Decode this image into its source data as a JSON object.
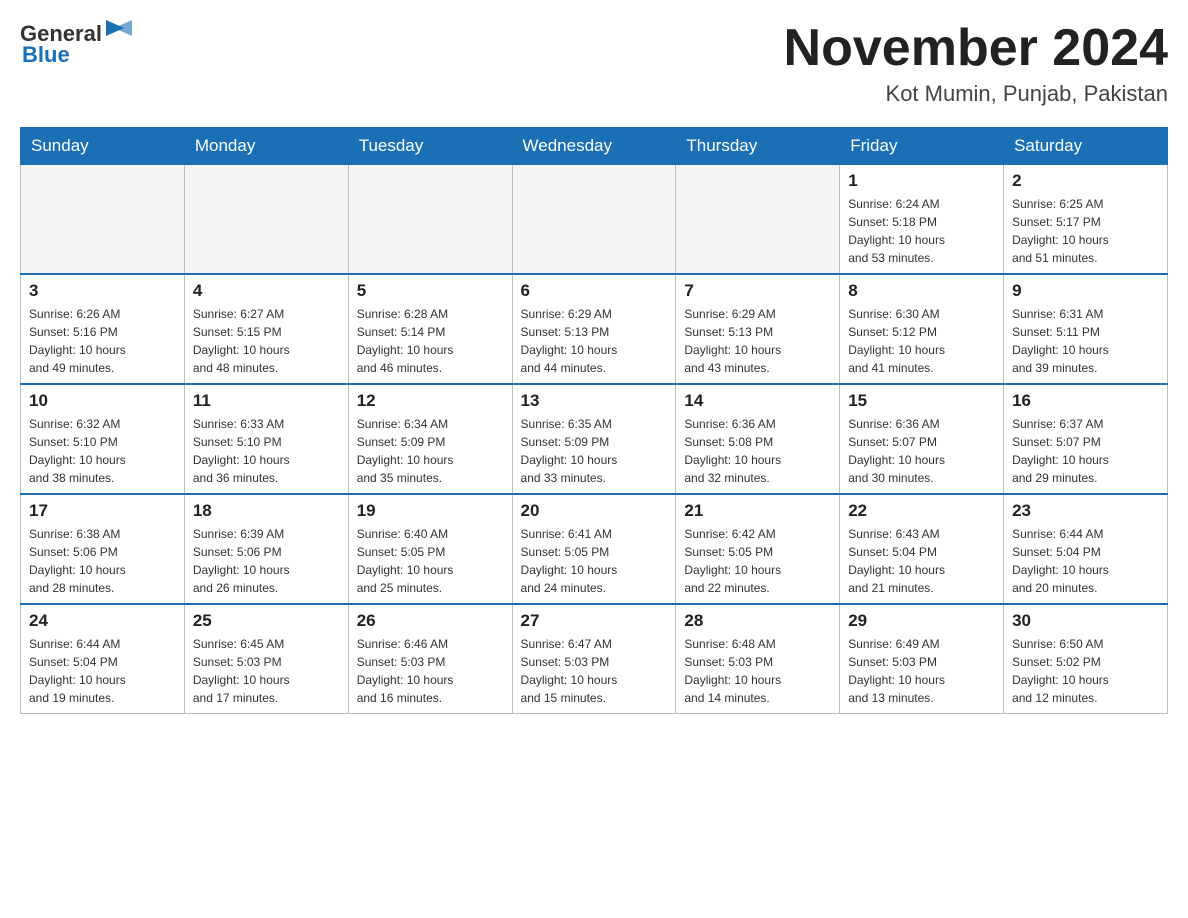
{
  "header": {
    "logo_general": "General",
    "logo_blue": "Blue",
    "title": "November 2024",
    "subtitle": "Kot Mumin, Punjab, Pakistan"
  },
  "weekdays": [
    "Sunday",
    "Monday",
    "Tuesday",
    "Wednesday",
    "Thursday",
    "Friday",
    "Saturday"
  ],
  "weeks": [
    [
      {
        "day": "",
        "info": ""
      },
      {
        "day": "",
        "info": ""
      },
      {
        "day": "",
        "info": ""
      },
      {
        "day": "",
        "info": ""
      },
      {
        "day": "",
        "info": ""
      },
      {
        "day": "1",
        "info": "Sunrise: 6:24 AM\nSunset: 5:18 PM\nDaylight: 10 hours\nand 53 minutes."
      },
      {
        "day": "2",
        "info": "Sunrise: 6:25 AM\nSunset: 5:17 PM\nDaylight: 10 hours\nand 51 minutes."
      }
    ],
    [
      {
        "day": "3",
        "info": "Sunrise: 6:26 AM\nSunset: 5:16 PM\nDaylight: 10 hours\nand 49 minutes."
      },
      {
        "day": "4",
        "info": "Sunrise: 6:27 AM\nSunset: 5:15 PM\nDaylight: 10 hours\nand 48 minutes."
      },
      {
        "day": "5",
        "info": "Sunrise: 6:28 AM\nSunset: 5:14 PM\nDaylight: 10 hours\nand 46 minutes."
      },
      {
        "day": "6",
        "info": "Sunrise: 6:29 AM\nSunset: 5:13 PM\nDaylight: 10 hours\nand 44 minutes."
      },
      {
        "day": "7",
        "info": "Sunrise: 6:29 AM\nSunset: 5:13 PM\nDaylight: 10 hours\nand 43 minutes."
      },
      {
        "day": "8",
        "info": "Sunrise: 6:30 AM\nSunset: 5:12 PM\nDaylight: 10 hours\nand 41 minutes."
      },
      {
        "day": "9",
        "info": "Sunrise: 6:31 AM\nSunset: 5:11 PM\nDaylight: 10 hours\nand 39 minutes."
      }
    ],
    [
      {
        "day": "10",
        "info": "Sunrise: 6:32 AM\nSunset: 5:10 PM\nDaylight: 10 hours\nand 38 minutes."
      },
      {
        "day": "11",
        "info": "Sunrise: 6:33 AM\nSunset: 5:10 PM\nDaylight: 10 hours\nand 36 minutes."
      },
      {
        "day": "12",
        "info": "Sunrise: 6:34 AM\nSunset: 5:09 PM\nDaylight: 10 hours\nand 35 minutes."
      },
      {
        "day": "13",
        "info": "Sunrise: 6:35 AM\nSunset: 5:09 PM\nDaylight: 10 hours\nand 33 minutes."
      },
      {
        "day": "14",
        "info": "Sunrise: 6:36 AM\nSunset: 5:08 PM\nDaylight: 10 hours\nand 32 minutes."
      },
      {
        "day": "15",
        "info": "Sunrise: 6:36 AM\nSunset: 5:07 PM\nDaylight: 10 hours\nand 30 minutes."
      },
      {
        "day": "16",
        "info": "Sunrise: 6:37 AM\nSunset: 5:07 PM\nDaylight: 10 hours\nand 29 minutes."
      }
    ],
    [
      {
        "day": "17",
        "info": "Sunrise: 6:38 AM\nSunset: 5:06 PM\nDaylight: 10 hours\nand 28 minutes."
      },
      {
        "day": "18",
        "info": "Sunrise: 6:39 AM\nSunset: 5:06 PM\nDaylight: 10 hours\nand 26 minutes."
      },
      {
        "day": "19",
        "info": "Sunrise: 6:40 AM\nSunset: 5:05 PM\nDaylight: 10 hours\nand 25 minutes."
      },
      {
        "day": "20",
        "info": "Sunrise: 6:41 AM\nSunset: 5:05 PM\nDaylight: 10 hours\nand 24 minutes."
      },
      {
        "day": "21",
        "info": "Sunrise: 6:42 AM\nSunset: 5:05 PM\nDaylight: 10 hours\nand 22 minutes."
      },
      {
        "day": "22",
        "info": "Sunrise: 6:43 AM\nSunset: 5:04 PM\nDaylight: 10 hours\nand 21 minutes."
      },
      {
        "day": "23",
        "info": "Sunrise: 6:44 AM\nSunset: 5:04 PM\nDaylight: 10 hours\nand 20 minutes."
      }
    ],
    [
      {
        "day": "24",
        "info": "Sunrise: 6:44 AM\nSunset: 5:04 PM\nDaylight: 10 hours\nand 19 minutes."
      },
      {
        "day": "25",
        "info": "Sunrise: 6:45 AM\nSunset: 5:03 PM\nDaylight: 10 hours\nand 17 minutes."
      },
      {
        "day": "26",
        "info": "Sunrise: 6:46 AM\nSunset: 5:03 PM\nDaylight: 10 hours\nand 16 minutes."
      },
      {
        "day": "27",
        "info": "Sunrise: 6:47 AM\nSunset: 5:03 PM\nDaylight: 10 hours\nand 15 minutes."
      },
      {
        "day": "28",
        "info": "Sunrise: 6:48 AM\nSunset: 5:03 PM\nDaylight: 10 hours\nand 14 minutes."
      },
      {
        "day": "29",
        "info": "Sunrise: 6:49 AM\nSunset: 5:03 PM\nDaylight: 10 hours\nand 13 minutes."
      },
      {
        "day": "30",
        "info": "Sunrise: 6:50 AM\nSunset: 5:02 PM\nDaylight: 10 hours\nand 12 minutes."
      }
    ]
  ]
}
